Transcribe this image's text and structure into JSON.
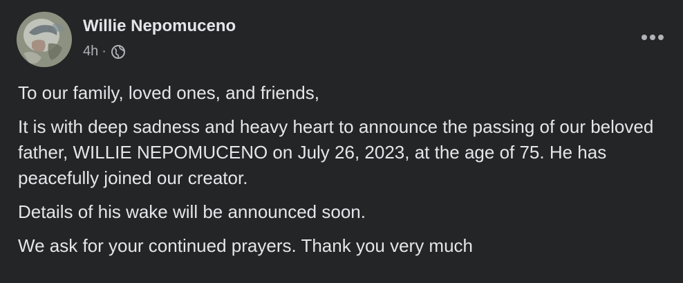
{
  "post": {
    "author": "Willie Nepomuceno",
    "time": "4h",
    "separator": "·",
    "privacy_icon": "globe-icon",
    "more_icon": "more-options-icon",
    "paragraphs": [
      "To our family, loved ones, and friends,",
      "It is with deep sadness and heavy heart to announce the passing of our beloved father, WILLIE NEPOMUCENO on July 26, 2023, at the age of 75. He has peacefully joined our creator.",
      "Details of his wake will be announced soon.",
      "We ask for your continued prayers. Thank you very much"
    ]
  },
  "colors": {
    "background": "#242526",
    "primary_text": "#e4e6eb",
    "secondary_text": "#b0b3b8"
  }
}
